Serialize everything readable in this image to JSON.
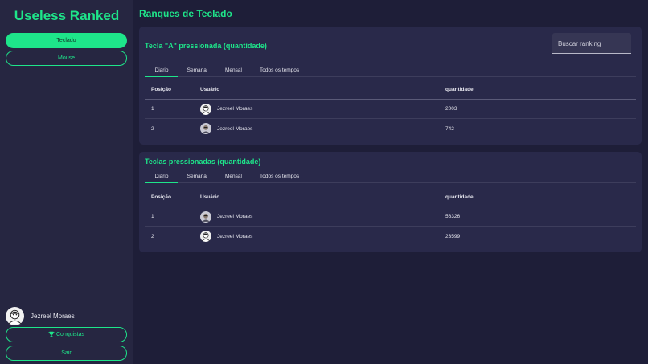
{
  "sidebar": {
    "app_title": "Useless Ranked",
    "nav": [
      {
        "label": "Teclado",
        "active": true
      },
      {
        "label": "Mouse",
        "active": false
      }
    ],
    "user": {
      "name": "Jezreel Moraes"
    },
    "achievements_label": "Conquistas",
    "logout_label": "Sair"
  },
  "main": {
    "page_title": "Ranques de Teclado",
    "search": {
      "placeholder": "Buscar ranking"
    },
    "cards": [
      {
        "title": "Tecla \"A\" pressionada (quantidade)",
        "tabs": [
          "Diario",
          "Semanal",
          "Mensal",
          "Todos os tempos"
        ],
        "active_tab": "Diario",
        "columns": [
          "Posição",
          "Usuário",
          "quantidade"
        ],
        "rows": [
          {
            "position": "1",
            "user": "Jezreel Moraes",
            "quantity": "2003"
          },
          {
            "position": "2",
            "user": "Jezreel Moraes",
            "quantity": "742"
          }
        ]
      },
      {
        "title": "Teclas pressionadas (quantidade)",
        "tabs": [
          "Diario",
          "Semanal",
          "Mensal",
          "Todos os tempos"
        ],
        "active_tab": "Diario",
        "columns": [
          "Posição",
          "Usuário",
          "quantidade"
        ],
        "rows": [
          {
            "position": "1",
            "user": "Jezreel Moraes",
            "quantity": "56326"
          },
          {
            "position": "2",
            "user": "Jezreel Moraes",
            "quantity": "23599"
          }
        ]
      }
    ]
  },
  "colors": {
    "accent": "#1ee58a",
    "background": "#1e1e38",
    "sidebar": "#262641",
    "card": "#29294a"
  },
  "icons": {
    "trophy": "trophy-icon",
    "avatar": "user-avatar"
  }
}
